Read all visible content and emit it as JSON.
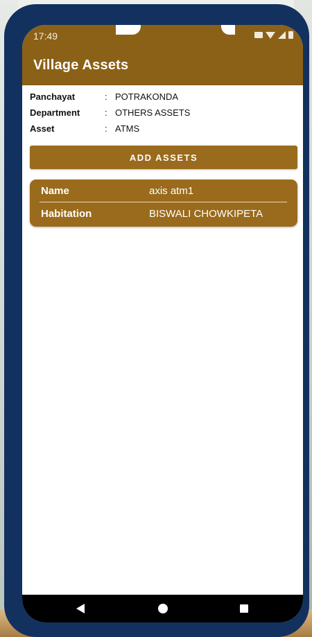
{
  "status_bar": {
    "time": "17:49"
  },
  "app_bar": {
    "title": "Village Assets"
  },
  "info": {
    "rows": [
      {
        "label": "Panchayat",
        "value": "POTRAKONDA"
      },
      {
        "label": "Department",
        "value": "OTHERS ASSETS"
      },
      {
        "label": "Asset",
        "value": "ATMS"
      }
    ],
    "separator": ":"
  },
  "add_button": {
    "label": "ADD ASSETS"
  },
  "asset_card": {
    "name_label": "Name",
    "name_value": "axis atm1",
    "habitation_label": "Habitation",
    "habitation_value": "BISWALI CHOWKIPETA"
  },
  "nav_bar": {
    "icons": [
      "back-icon",
      "home-icon",
      "recent-apps-icon"
    ]
  },
  "colors": {
    "accent": "#9a6b1c",
    "app_bar": "#8b6117",
    "phone_frame": "#13315f"
  }
}
